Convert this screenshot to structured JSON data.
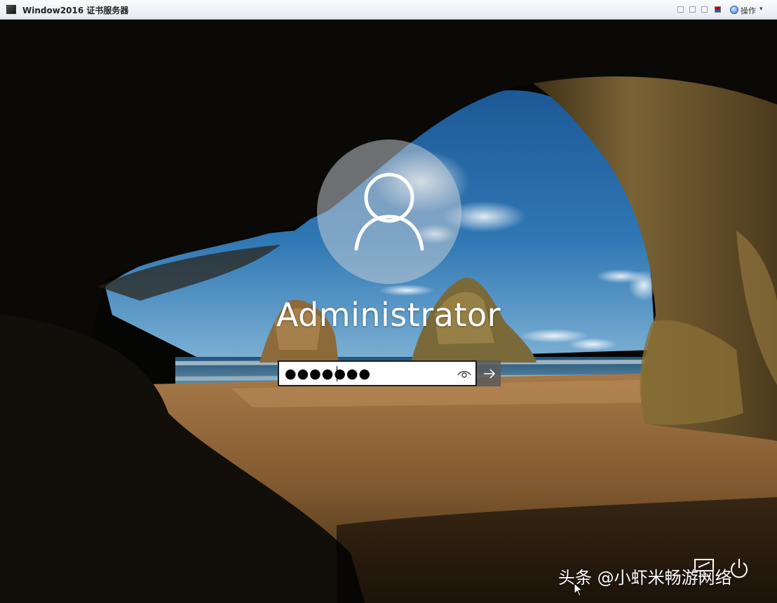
{
  "window": {
    "title": "Window2016 证书服务器",
    "operations_label": "操作"
  },
  "login": {
    "username": "Administrator",
    "password_value": "●●●●●●●",
    "reveal_icon": "eye-icon",
    "submit_icon": "arrow-right-icon"
  },
  "system_icons": [
    "network-icon",
    "power-icon"
  ],
  "watermark": "头条 @小虾米畅游网络",
  "colors": {
    "sky": "#2b6ea8",
    "sand": "#8a6238",
    "rock": "#6e5630",
    "avatar_circle": "#c8d0d6",
    "submit_button": "#5a5a5a"
  }
}
